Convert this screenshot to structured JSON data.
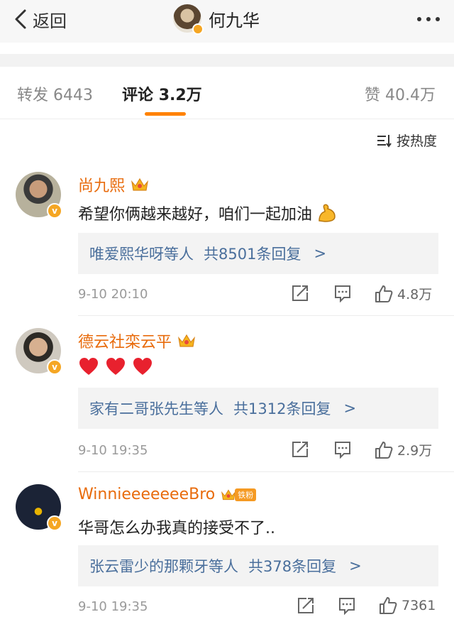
{
  "nav": {
    "back_label": "返回",
    "title": "何九华"
  },
  "tabs": {
    "repost_label": "转发",
    "repost_count": "6443",
    "comment_label": "评论",
    "comment_count": "3.2万",
    "like_label": "赞",
    "like_count": "40.4万"
  },
  "sort": {
    "label": "按热度"
  },
  "comments": [
    {
      "author": "尚九熙",
      "text": "希望你俩越来越好，咱们一起加油",
      "replies_who": "唯爱熙华呀等人",
      "replies_count": "共8501条回复",
      "reply_arrow": ">",
      "time": "9-10 20:10",
      "likes": "4.8万"
    },
    {
      "author": "德云社栾云平",
      "replies_who": "家有二哥张先生等人",
      "replies_count": "共1312条回复",
      "reply_arrow": ">",
      "time": "9-10 19:35",
      "likes": "2.9万"
    },
    {
      "author": "WinnieeeeeeeBro",
      "fan_badge": "铁粉",
      "text": "华哥怎么办我真的接受不了..",
      "replies_who": "张云雷少的那颗牙等人",
      "replies_count": "共378条回复",
      "reply_arrow": ">",
      "time": "9-10 19:35",
      "likes": "7361"
    }
  ],
  "colors": {
    "accent": "#ff8200",
    "author": "#e86b0c",
    "link": "#4a6f9c",
    "verified": "#f5a623"
  },
  "icons": [
    "chevron-left-icon",
    "more-dots-icon",
    "sort-icon",
    "crown-icon",
    "heart-icon",
    "muscle-icon",
    "repost-icon",
    "comment-icon",
    "thumbs-up-icon"
  ]
}
